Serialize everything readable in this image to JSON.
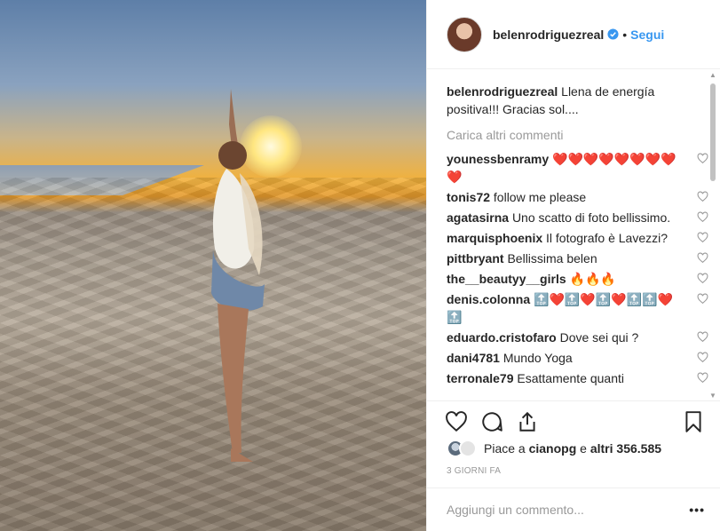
{
  "post": {
    "username": "belenrodriguezreal",
    "follow_label": "Segui",
    "dot": "•",
    "caption": "Llena de energía positiva!!! Gracias sol...."
  },
  "comments": {
    "load_more": "Carica altri commenti",
    "items": [
      {
        "user": "younessbenramy",
        "text": "❤️❤️❤️❤️❤️❤️❤️❤️❤️"
      },
      {
        "user": "tonis72",
        "text": "follow me please"
      },
      {
        "user": "agatasirna",
        "text": "Uno scatto di foto bellissimo."
      },
      {
        "user": "marquisphoenix",
        "text": "Il fotografo è Lavezzi?"
      },
      {
        "user": "pittbryant",
        "text": "Bellissima belen"
      },
      {
        "user": "the__beautyy__girls",
        "text": "🔥🔥🔥"
      },
      {
        "user": "denis.colonna",
        "text": "🔝❤️🔝❤️🔝❤️🔝🔝❤️🔝"
      },
      {
        "user": "eduardo.cristofaro",
        "text": "Dove sei qui ?"
      },
      {
        "user": "dani4781",
        "text": "Mundo Yoga"
      },
      {
        "user": "terronale79",
        "text": "Esattamente quanti"
      }
    ]
  },
  "likes": {
    "prefix": "Piace a ",
    "user": "cianopg",
    "middle": " e ",
    "count": "altri 356.585"
  },
  "time": "3 GIORNI FA",
  "add_comment": {
    "placeholder": "Aggiungi un commento..."
  },
  "more_label": "•••",
  "colors": {
    "link": "#3897f0",
    "muted": "#999999",
    "text": "#262626"
  }
}
